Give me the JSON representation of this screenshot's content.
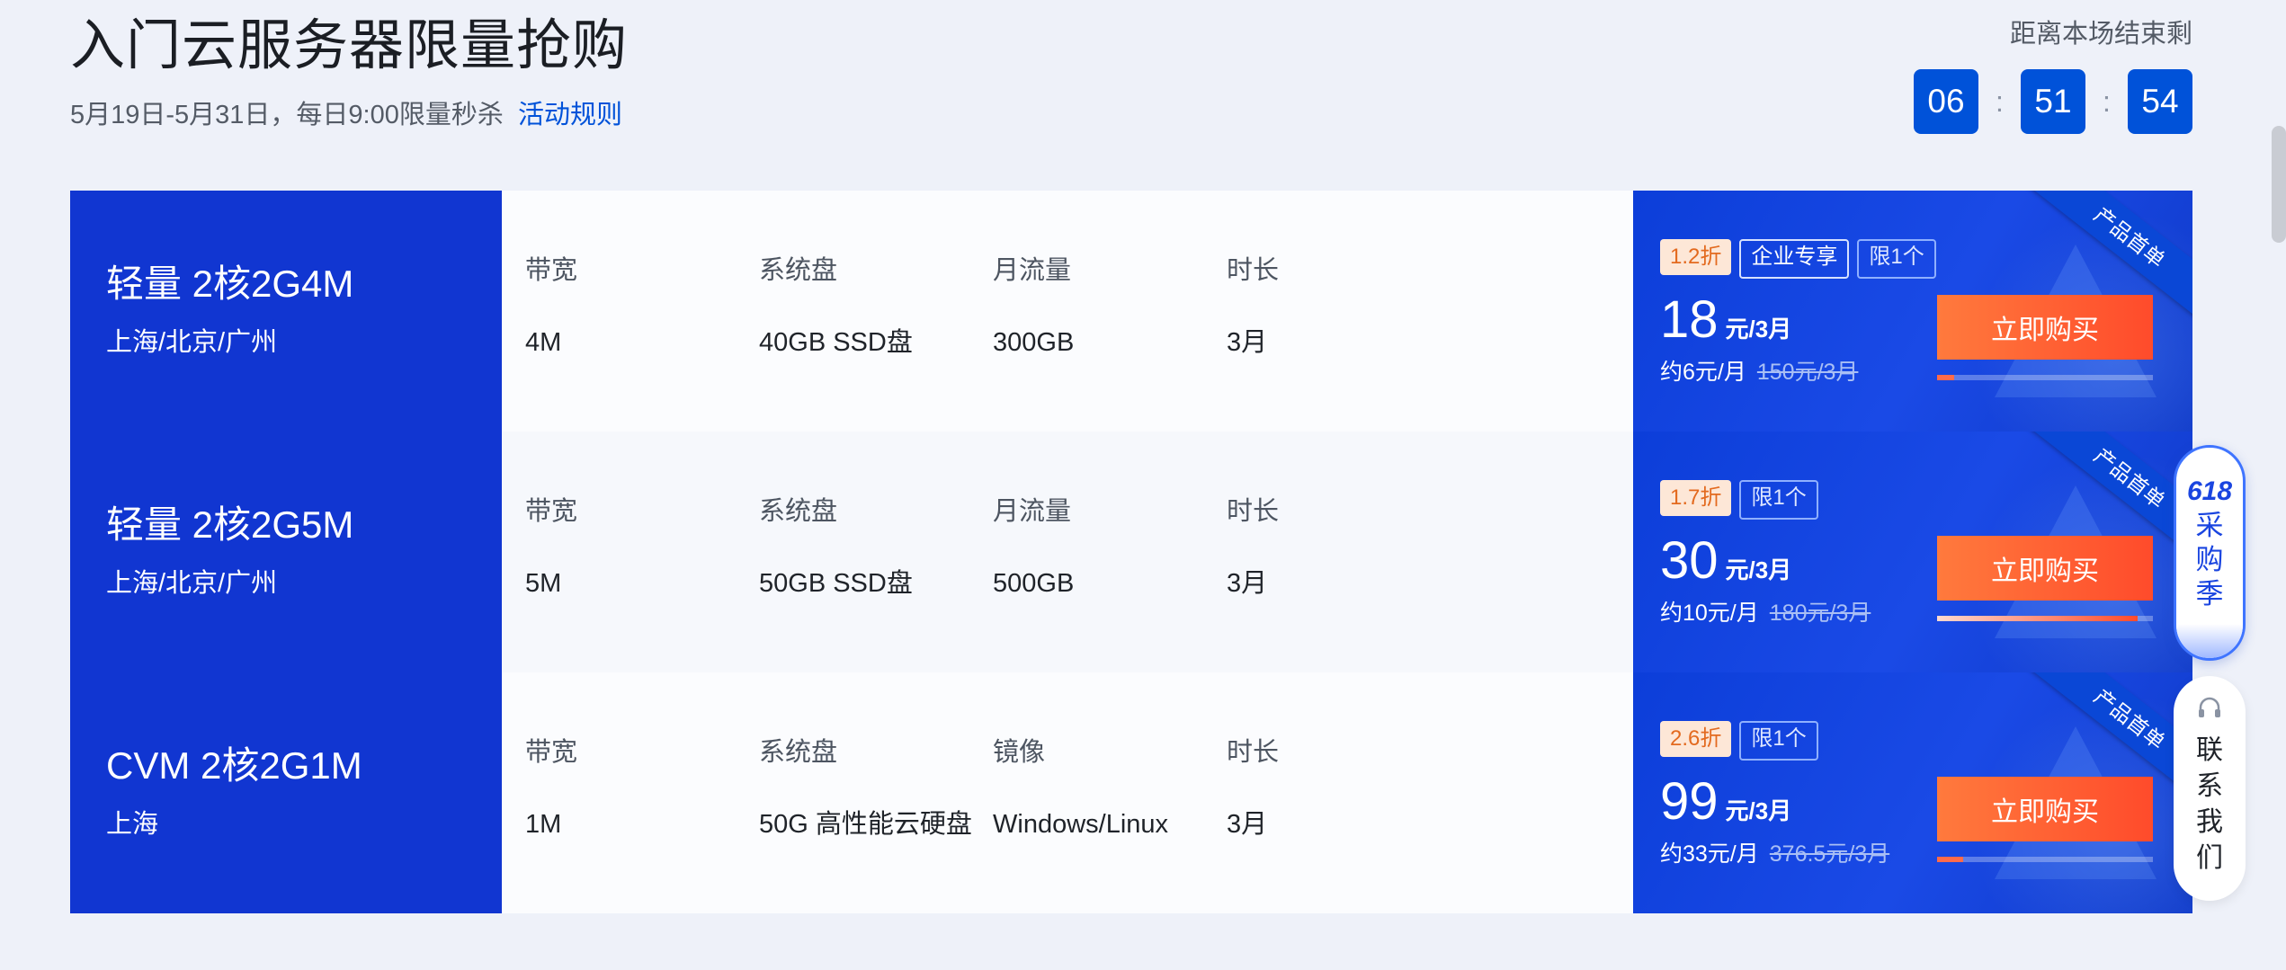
{
  "header": {
    "title": "入门云服务器限量抢购",
    "subtitle": "5月19日-5月31日，每日9:00限量秒杀",
    "rules_link": "活动规则"
  },
  "countdown": {
    "label": "距离本场结束剩",
    "hours": "06",
    "minutes": "51",
    "seconds": "54",
    "separator": ":"
  },
  "products": [
    {
      "name": "轻量 2核2G4M",
      "region": "上海/北京/广州",
      "specs": [
        {
          "label": "带宽",
          "value": "4M"
        },
        {
          "label": "系统盘",
          "value": "40GB SSD盘"
        },
        {
          "label": "月流量",
          "value": "300GB"
        },
        {
          "label": "时长",
          "value": "3月"
        }
      ],
      "ribbon": "产品首单",
      "tags": {
        "discount": "1.2折",
        "enterprise": "企业专享",
        "limit": "限1个"
      },
      "price": "18",
      "price_unit": "元/3月",
      "per_month": "约6元/月",
      "original_price": "150元/3月",
      "buy_label": "立即购买",
      "progress_fraction": 0.08
    },
    {
      "name": "轻量 2核2G5M",
      "region": "上海/北京/广州",
      "specs": [
        {
          "label": "带宽",
          "value": "5M"
        },
        {
          "label": "系统盘",
          "value": "50GB SSD盘"
        },
        {
          "label": "月流量",
          "value": "500GB"
        },
        {
          "label": "时长",
          "value": "3月"
        }
      ],
      "ribbon": "产品首单",
      "tags": {
        "discount": "1.7折",
        "limit": "限1个"
      },
      "price": "30",
      "price_unit": "元/3月",
      "per_month": "约10元/月",
      "original_price": "180元/3月",
      "buy_label": "立即购买",
      "progress_fraction": 0.93
    },
    {
      "name": "CVM 2核2G1M",
      "region": "上海",
      "specs": [
        {
          "label": "带宽",
          "value": "1M"
        },
        {
          "label": "系统盘",
          "value": "50G 高性能云硬盘"
        },
        {
          "label": "镜像",
          "value": "Windows/Linux"
        },
        {
          "label": "时长",
          "value": "3月"
        }
      ],
      "ribbon": "产品首单",
      "tags": {
        "discount": "2.6折",
        "limit": "限1个"
      },
      "price": "99",
      "price_unit": "元/3月",
      "per_month": "约33元/月",
      "original_price": "376.5元/3月",
      "buy_label": "立即购买",
      "progress_fraction": 0.12
    }
  ],
  "side_widgets": {
    "promo_logo": "618",
    "promo_text": [
      "采",
      "购",
      "季"
    ],
    "contact_text": [
      "联",
      "系",
      "我",
      "们"
    ]
  },
  "colors": {
    "brand_blue": "#0052d9",
    "card_blue": "#1136d1",
    "buy_orange": "#ff5a2e"
  }
}
